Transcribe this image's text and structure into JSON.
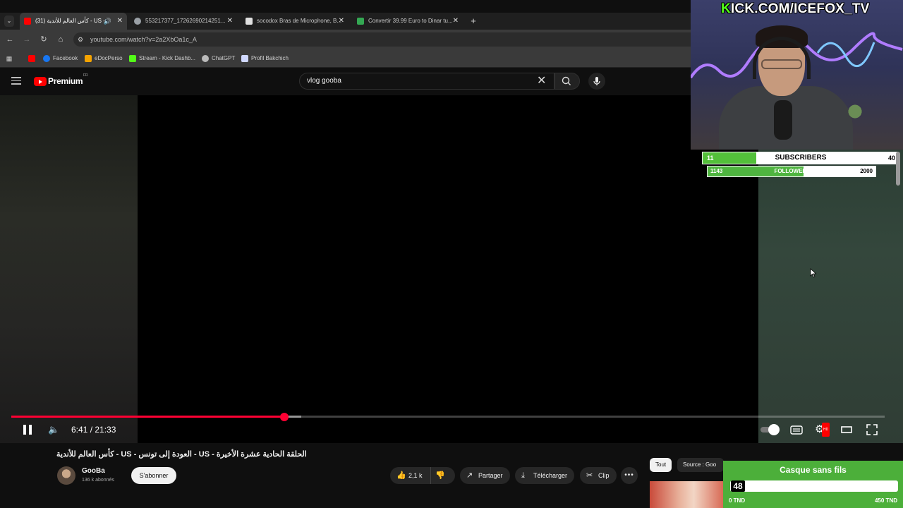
{
  "browser": {
    "tabs": [
      {
        "title": "(31) كأس العالم للأندية - US -",
        "active": true,
        "favicon": "youtube-icon",
        "color": "#ff0000"
      },
      {
        "title": "553217377_17262690214251...",
        "active": false,
        "favicon": "globe-icon",
        "color": "#9aa0a6"
      },
      {
        "title": "socodox Bras de Microphone, B...",
        "active": false,
        "favicon": "amazon-icon",
        "color": "#e0e0e0"
      },
      {
        "title": "Convertir 39.99 Euro to Dinar tu...",
        "active": false,
        "favicon": "currency-icon",
        "color": "#34a853"
      }
    ],
    "url": "youtube.com/watch?v=2a2XbOa1c_A",
    "bookmarks": [
      {
        "label": "",
        "icon": "youtube-icon",
        "color": "#ff0000"
      },
      {
        "label": "Facebook",
        "icon": "facebook-icon",
        "color": "#1877f2"
      },
      {
        "label": "eDocPerso",
        "icon": "edoc-icon",
        "color": "#f4a300"
      },
      {
        "label": "Stream - Kick Dashb...",
        "icon": "kick-icon",
        "color": "#53fc18"
      },
      {
        "label": "ChatGPT",
        "icon": "chatgpt-icon",
        "color": "#bbbbbb"
      },
      {
        "label": "Profil Bakchich",
        "icon": "profile-icon",
        "color": "#d0d8ff"
      }
    ]
  },
  "youtube": {
    "logo_text": "Premium",
    "region": "FR",
    "search_query": "vlog gooba",
    "player": {
      "time": "6:41 / 21:33",
      "progress": 0.3126,
      "buffered": 0.332
    },
    "video_title": "الحلقة الحادية عشرة الأخيرة - US - العودة إلى تونس - US - كأس العالم للأندية",
    "channel": {
      "name": "GooBa",
      "subscribers": "136 k abonnés",
      "subscribe_label": "S'abonner"
    },
    "actions": {
      "likes": "2,1 k",
      "share": "Partager",
      "download": "Télécharger",
      "clip": "Clip"
    },
    "chips": {
      "all": "Tout",
      "source": "Source : Goo"
    }
  },
  "overlay": {
    "kick_url_k": "K",
    "kick_url_rest": "ICK.COM/ICEFOX_TV",
    "subscribers": {
      "current": "11",
      "label": "SUBSCRIBERS",
      "goal": "40",
      "fraction": 0.275
    },
    "followers": {
      "current": "1143",
      "label": "FOLLOWERS",
      "goal": "2000",
      "fraction": 0.5715
    },
    "donation": {
      "title": "Casque sans fils",
      "count": "48",
      "min": "0 TND",
      "max": "450 TND",
      "fraction": 0.1067
    }
  },
  "colors": {
    "yt_red": "#ff0033",
    "kick_green": "#53fc18",
    "goal_green": "#4caf3a"
  }
}
